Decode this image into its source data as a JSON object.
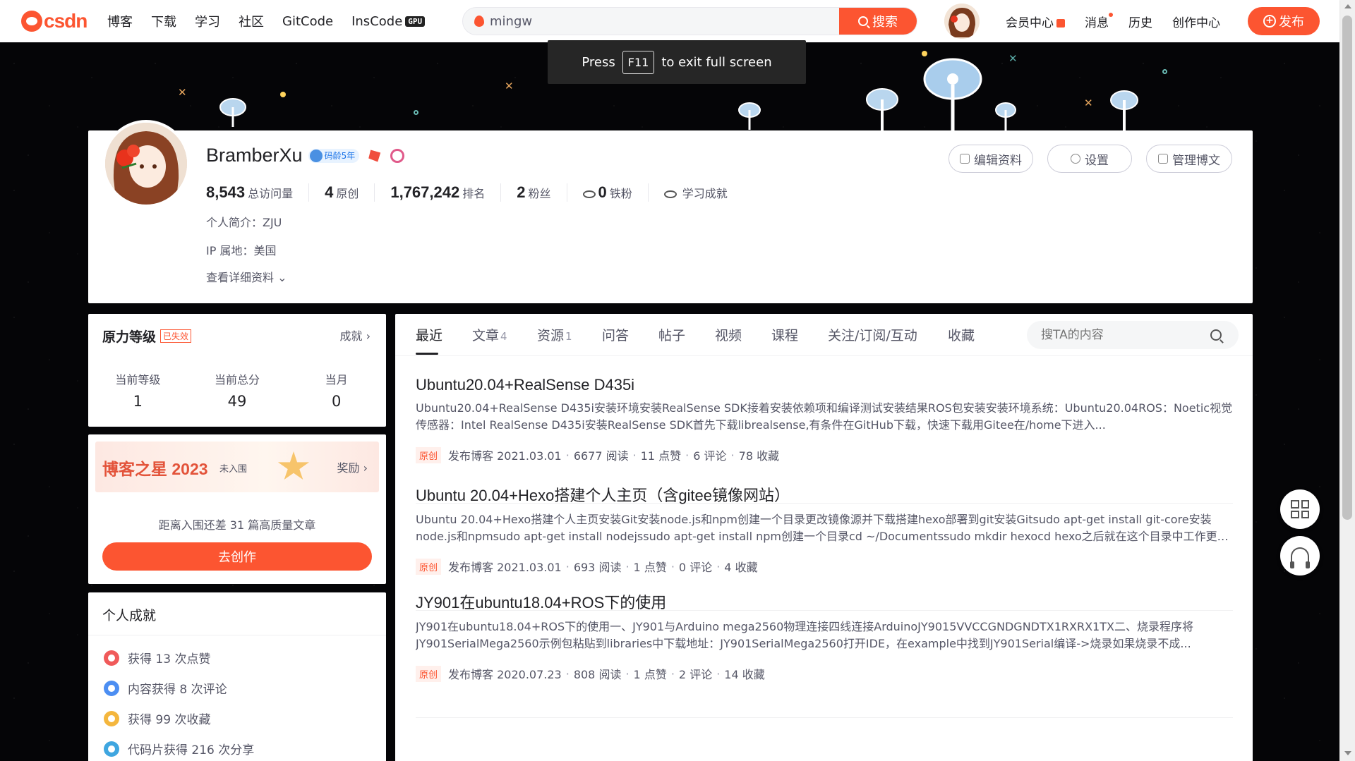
{
  "nav": {
    "logo_text": "CSDN",
    "links": [
      "博客",
      "下载",
      "学习",
      "社区",
      "GitCode",
      "InsCode"
    ],
    "gpu_badge": "GPU",
    "search_value": "mingw",
    "search_button": "搜索",
    "right_links": [
      "会员中心",
      "消息",
      "历史",
      "创作中心"
    ],
    "publish_label": "发布"
  },
  "fullscreen_toast": {
    "prefix": "Press",
    "key": "F11",
    "suffix": "to exit full screen"
  },
  "profile": {
    "name": "BramberXu",
    "age_badge": "码龄5年",
    "stats": [
      {
        "num": "8,543",
        "label": "总访问量"
      },
      {
        "num": "4",
        "label": "原创"
      },
      {
        "num": "1,767,242",
        "label": "排名"
      },
      {
        "num": "2",
        "label": "粉丝"
      },
      {
        "num": "0",
        "label": "铁粉"
      }
    ],
    "learning_label": "学习成就",
    "intro": "个人简介：ZJU",
    "ip": "IP 属地：美国",
    "more": "查看详细资料",
    "buttons": [
      "编辑资料",
      "设置",
      "管理博文"
    ]
  },
  "rank": {
    "title": "原力等级",
    "expired": "已失效",
    "link": "成就",
    "cols": [
      {
        "label": "当前等级",
        "value": "1"
      },
      {
        "label": "当前总分",
        "value": "49"
      },
      {
        "label": "当月",
        "value": "0"
      }
    ]
  },
  "blog_star": {
    "title": "博客之星 2023",
    "status": "未入围",
    "reward": "奖励",
    "distance": "距离入围还差 31 篇高质量文章",
    "create_button": "去创作"
  },
  "achievements": {
    "title": "个人成就",
    "items": [
      "获得 13 次点赞",
      "内容获得 8 次评论",
      "获得 99 次收藏",
      "代码片获得 216 次分享"
    ]
  },
  "tabs": [
    {
      "label": "最近",
      "count": ""
    },
    {
      "label": "文章",
      "count": "4"
    },
    {
      "label": "资源",
      "count": "1"
    },
    {
      "label": "问答",
      "count": ""
    },
    {
      "label": "帖子",
      "count": ""
    },
    {
      "label": "视频",
      "count": ""
    },
    {
      "label": "课程",
      "count": ""
    },
    {
      "label": "关注/订阅/互动",
      "count": ""
    },
    {
      "label": "收藏",
      "count": ""
    }
  ],
  "ta_search_placeholder": "搜TA的内容",
  "articles": [
    {
      "title": "Ubuntu20.04+RealSense D435i",
      "desc": "Ubuntu20.04+RealSense D435i安装环境安装RealSense SDK接着安装依赖项和编译测试安装结果ROS包安装安装环境系统：Ubuntu20.04ROS：Noetic视觉传感器：Intel RealSense D435i安装RealSense SDK首先下载librealsense,有条件在GitHub下载，快速下载用Gitee在/home下进入...",
      "tag": "原创",
      "date": "发布博客 2021.03.01",
      "reads": "6677 阅读",
      "likes": "11 点赞",
      "comments": "6 评论",
      "favs": "78 收藏"
    },
    {
      "title": "Ubuntu 20.04+Hexo搭建个人主页（含gitee镜像网站）",
      "desc": "Ubuntu 20.04+Hexo搭建个人主页安装Git安装node.js和npm创建一个目录更改镜像源并下载搭建hexo部署到git安装Gitsudo apt-get install git-core安装node.js和npmsudo apt-get install nodejssudo apt-get install npm创建一个目录cd ~/Documentssudo mkdir hexocd hexo之后就在这个目录中工作更改镜像...",
      "tag": "原创",
      "date": "发布博客 2021.03.01",
      "reads": "693 阅读",
      "likes": "1 点赞",
      "comments": "0 评论",
      "favs": "4 收藏"
    },
    {
      "title": "JY901在ubuntu18.04+ROS下的使用",
      "desc": "JY901在ubuntu18.04+ROS下的使用一、JY901与Arduino mega2560物理连接四线连接ArduinoJY9015VVCCGNDGNDTX1RXRX1TX二、烧录程序将JY901SerialMega2560示例包粘贴到libraries中下载地址：JY901SerialMega2560打开IDE，在example中找到JY901Serial编译->烧录如果烧录不成...",
      "tag": "原创",
      "date": "发布博客 2020.07.23",
      "reads": "808 阅读",
      "likes": "1 点赞",
      "comments": "2 评论",
      "favs": "14 收藏"
    }
  ],
  "colors": {
    "accent": "#fc5531",
    "text": "#222226",
    "muted": "#555666",
    "banner_bg": "#050505"
  }
}
